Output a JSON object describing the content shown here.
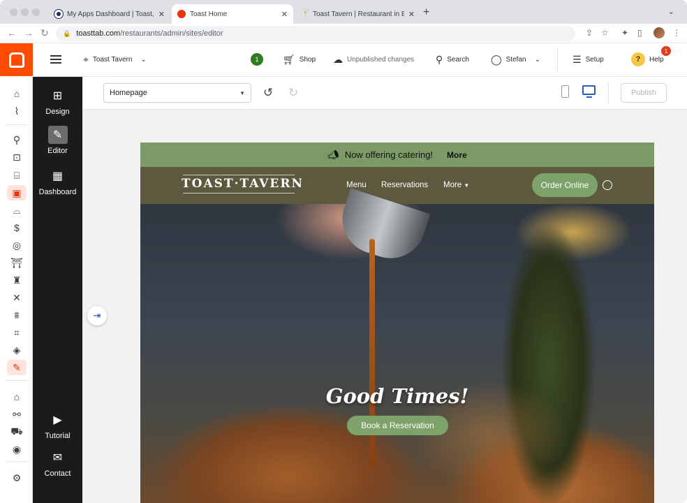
{
  "browser": {
    "tabs": [
      {
        "title": "My Apps Dashboard | Toast, In",
        "favicon_color": "#1a2b6b",
        "active": false
      },
      {
        "title": "Toast Home",
        "favicon_color": "#ff4c00",
        "active": true
      },
      {
        "title": "Toast Tavern | Restaurant in B",
        "favicon_color": "#333333",
        "active": false
      }
    ],
    "new_tab": "+",
    "address": {
      "host": "toasttab.com",
      "path": "/restaurants/admin/sites/editor"
    }
  },
  "header": {
    "location": "Toast Tavern",
    "notifications_count": "1",
    "shop": "Shop",
    "unpublished": "Unpublished changes",
    "search": "Search",
    "user": "Stefan",
    "setup": "Setup",
    "help": "Help",
    "help_icon": "?",
    "help_badge": "1"
  },
  "editor_sidebar": {
    "design": "Design",
    "editor": "Editor",
    "dashboard": "Dashboard",
    "tutorial": "Tutorial",
    "contact": "Contact"
  },
  "toolbar": {
    "page_select": "Homepage",
    "publish": "Publish"
  },
  "site": {
    "promo_text": "Now offering catering!",
    "promo_more": "More",
    "brand": "TOAST·TAVERN",
    "nav": {
      "menu": "Menu",
      "reservations": "Reservations",
      "more": "More"
    },
    "order_online": "Order Online",
    "headline": "Good Times!",
    "cta": "Book a Reservation"
  },
  "colors": {
    "brand_orange": "#ff4c00",
    "site_green": "#7da36a",
    "site_nav": "#5d593f",
    "promo_bar": "#7c9a65",
    "sidebar_dark": "#1b1b1b"
  }
}
